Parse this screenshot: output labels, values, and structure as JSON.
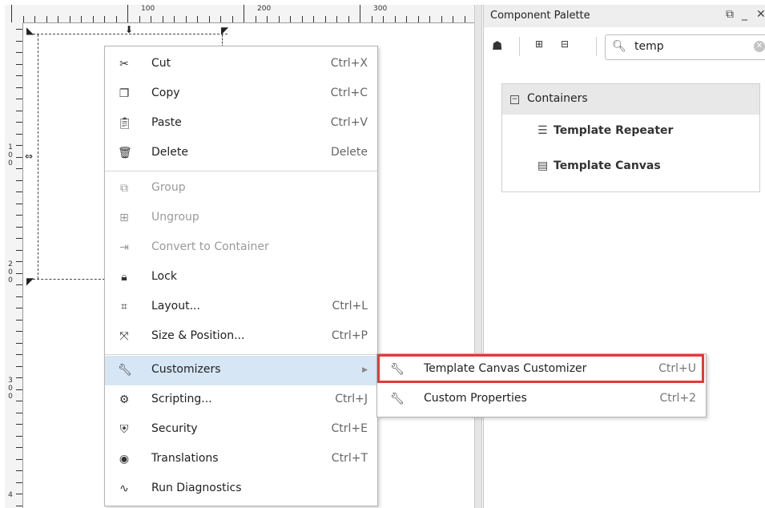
{
  "ruler": {
    "top_labels": [
      "100",
      "200",
      "300"
    ],
    "left_labels": [
      [
        "1",
        "0",
        "0"
      ],
      [
        "2",
        "0",
        "0"
      ],
      [
        "3",
        "0",
        "0"
      ],
      [
        "4"
      ]
    ]
  },
  "palette": {
    "title": "Component Palette",
    "restore_icon": "restore-icon",
    "minimize_icon": "minimize-icon",
    "close_icon": "close-icon",
    "search_value": "temp",
    "tree": {
      "group_label": "Containers",
      "items": [
        {
          "label": "Template Repeater",
          "icon": "template-repeater-icon"
        },
        {
          "label": "Template Canvas",
          "icon": "template-canvas-icon"
        }
      ]
    }
  },
  "menu": {
    "items": [
      {
        "label": "Cut",
        "shortcut": "Ctrl+X",
        "icon": "scissors-icon"
      },
      {
        "label": "Copy",
        "shortcut": "Ctrl+C",
        "icon": "copy-icon"
      },
      {
        "label": "Paste",
        "shortcut": "Ctrl+V",
        "icon": "paste-icon"
      },
      {
        "label": "Delete",
        "shortcut": "Delete",
        "icon": "trash-icon"
      },
      {
        "label": "Group",
        "shortcut": "",
        "icon": "group-icon"
      },
      {
        "label": "Ungroup",
        "shortcut": "",
        "icon": "ungroup-icon"
      },
      {
        "label": "Convert to Container",
        "shortcut": "",
        "icon": "convert-container-icon"
      },
      {
        "label": "Lock",
        "shortcut": "",
        "icon": "lock-icon"
      },
      {
        "label": "Layout...",
        "shortcut": "Ctrl+L",
        "icon": "layout-icon"
      },
      {
        "label": "Size & Position...",
        "shortcut": "Ctrl+P",
        "icon": "size-position-icon"
      },
      {
        "label": "Customizers",
        "shortcut": "",
        "icon": "wrench-icon"
      },
      {
        "label": "Scripting...",
        "shortcut": "Ctrl+J",
        "icon": "scripting-icon"
      },
      {
        "label": "Security",
        "shortcut": "Ctrl+E",
        "icon": "shield-icon"
      },
      {
        "label": "Translations",
        "shortcut": "Ctrl+T",
        "icon": "globe-icon"
      },
      {
        "label": "Run Diagnostics",
        "shortcut": "",
        "icon": "diagnostics-icon"
      }
    ]
  },
  "submenu": {
    "items": [
      {
        "label": "Template Canvas Customizer",
        "shortcut": "Ctrl+U",
        "icon": "wrench-icon"
      },
      {
        "label": "Custom Properties",
        "shortcut": "Ctrl+2",
        "icon": "wrench-icon"
      }
    ]
  },
  "colors": {
    "highlight": "#d6e6f5",
    "annotation_red": "#e53935",
    "disabled_text": "#9a9a9a"
  }
}
